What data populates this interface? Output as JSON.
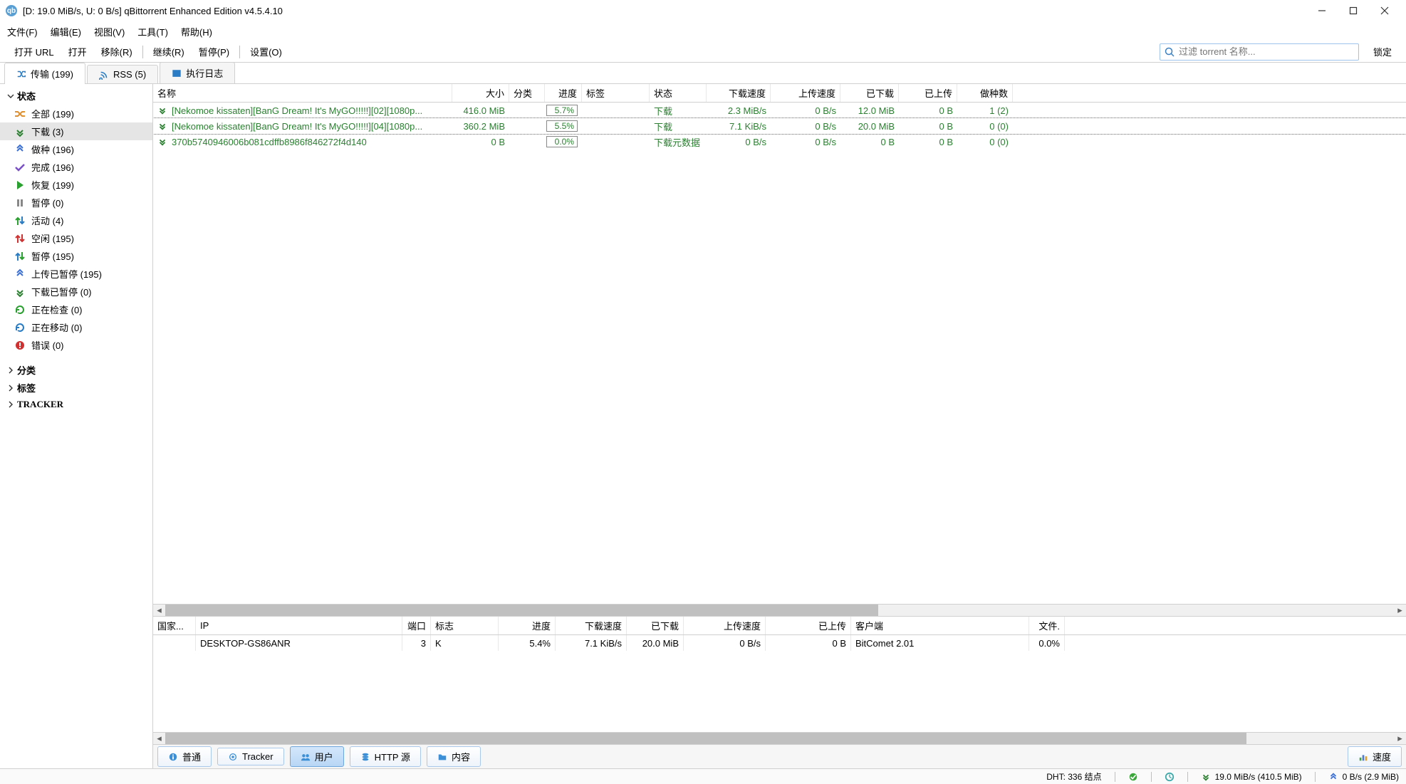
{
  "title": "[D: 19.0 MiB/s, U: 0 B/s] qBittorrent Enhanced Edition v4.5.4.10",
  "menubar": [
    "文件(F)",
    "编辑(E)",
    "视图(V)",
    "工具(T)",
    "帮助(H)"
  ],
  "toolbar": {
    "open_url": "打开 URL",
    "open": "打开",
    "remove": "移除(R)",
    "resume": "继续(R)",
    "pause": "暂停(P)",
    "settings": "设置(O)",
    "lock": "锁定"
  },
  "search_placeholder": "过滤 torrent 名称...",
  "tabs": {
    "transfers": "传输 (199)",
    "rss": "RSS (5)",
    "log": "执行日志"
  },
  "sidebar": {
    "status_header": "状态",
    "items": [
      {
        "label": "全部 (199)"
      },
      {
        "label": "下载 (3)"
      },
      {
        "label": "做种 (196)"
      },
      {
        "label": "完成 (196)"
      },
      {
        "label": "恢复 (199)"
      },
      {
        "label": "暂停 (0)"
      },
      {
        "label": "活动 (4)"
      },
      {
        "label": "空闲 (195)"
      },
      {
        "label": "暂停 (195)"
      },
      {
        "label": "上传已暂停 (195)"
      },
      {
        "label": "下载已暂停 (0)"
      },
      {
        "label": "正在检查 (0)"
      },
      {
        "label": "正在移动 (0)"
      },
      {
        "label": "错误 (0)"
      }
    ],
    "category": "分类",
    "tags": "标签",
    "tracker": "TRACKER"
  },
  "torrent_columns": {
    "name": "名称",
    "size": "大小",
    "category": "分类",
    "progress": "进度",
    "tags": "标签",
    "status": "状态",
    "down_speed": "下载速度",
    "up_speed": "上传速度",
    "downloaded": "已下载",
    "uploaded": "已上传",
    "seeds": "做种数"
  },
  "torrents": [
    {
      "name": "[Nekomoe kissaten][BanG Dream! It's MyGO!!!!!][02][1080p...",
      "size": "416.0 MiB",
      "progress": "5.7%",
      "status": "下载",
      "dspd": "2.3 MiB/s",
      "uspd": "0 B/s",
      "dl": "12.0 MiB",
      "ul": "0 B",
      "seeds": "1 (2)"
    },
    {
      "name": "[Nekomoe kissaten][BanG Dream! It's MyGO!!!!!][04][1080p...",
      "size": "360.2 MiB",
      "progress": "5.5%",
      "status": "下载",
      "dspd": "7.1 KiB/s",
      "uspd": "0 B/s",
      "dl": "20.0 MiB",
      "ul": "0 B",
      "seeds": "0 (0)"
    },
    {
      "name": "370b5740946006b081cdffb8986f846272f4d140",
      "size": "0 B",
      "progress": "0.0%",
      "status": "下载元数据",
      "dspd": "0 B/s",
      "uspd": "0 B/s",
      "dl": "0 B",
      "ul": "0 B",
      "seeds": "0 (0)"
    }
  ],
  "peer_columns": {
    "country": "国家...",
    "ip": "IP",
    "port": "端口",
    "flags": "标志",
    "progress": "进度",
    "dspd": "下载速度",
    "dl": "已下载",
    "uspd": "上传速度",
    "ul": "已上传",
    "client": "客户端",
    "file": "文件."
  },
  "peers": [
    {
      "country": "",
      "ip": "DESKTOP-GS86ANR",
      "port": "3",
      "flags": "K",
      "progress": "5.4%",
      "dspd": "7.1 KiB/s",
      "dl": "20.0 MiB",
      "uspd": "0 B/s",
      "ul": "0 B",
      "client": "BitComet 2.01",
      "file": "0.0%"
    }
  ],
  "detail_tabs": {
    "general": "普通",
    "tracker": "Tracker",
    "peer": "用户",
    "http": "HTTP 源",
    "content": "内容",
    "speed": "速度"
  },
  "statusbar": {
    "dht": "DHT: 336 结点",
    "down": "19.0 MiB/s (410.5 MiB)",
    "up": "0 B/s (2.9 MiB)"
  }
}
